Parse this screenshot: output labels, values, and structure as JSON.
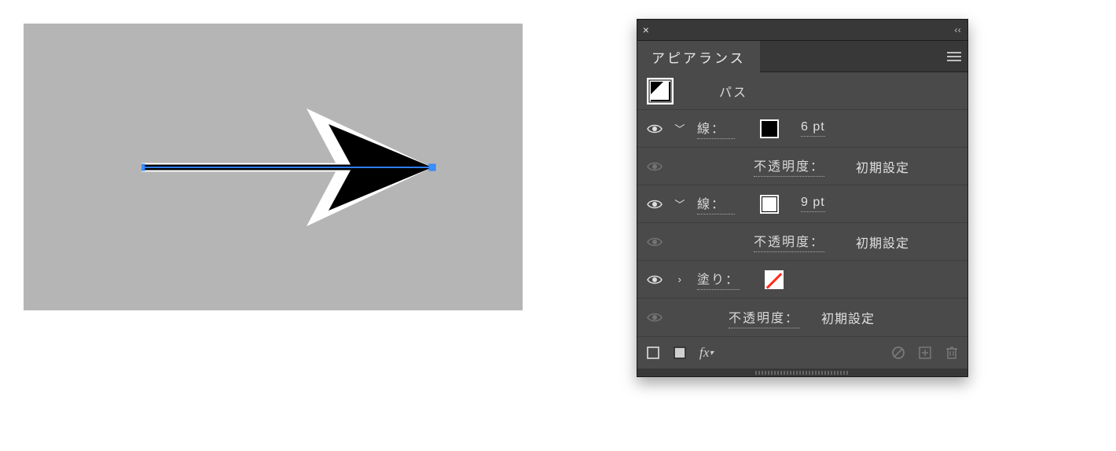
{
  "panel": {
    "title": "アピアランス",
    "object_type": "パス",
    "opacity_label": "不透明度：",
    "opacity_default": "初期設定",
    "stroke_label": "線：",
    "fill_label": "塗り：",
    "rows": {
      "stroke1": {
        "weight": "6 pt",
        "color": "#000000"
      },
      "stroke2": {
        "weight": "9 pt",
        "color": "#ffffff"
      }
    }
  },
  "colors": {
    "panel_bg": "#4a4a4a",
    "panel_chrome": "#383838",
    "canvas_bg": "#b5b5b5",
    "selection": "#2f7dff"
  }
}
